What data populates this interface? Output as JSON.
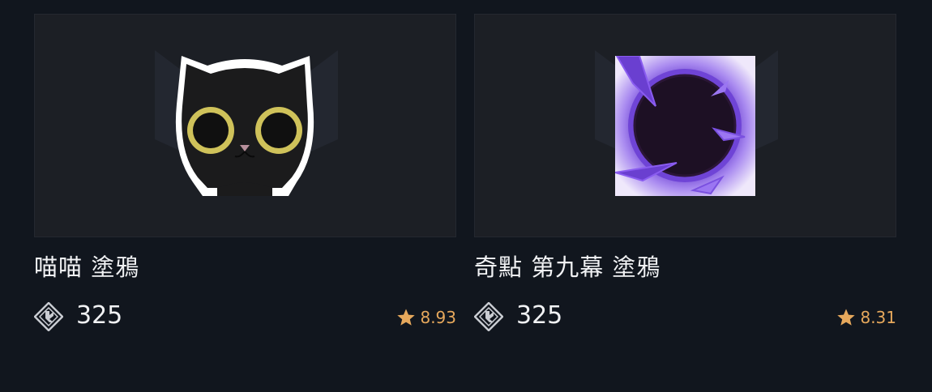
{
  "items": [
    {
      "title": "喵喵 塗鴉",
      "price": "325",
      "rating": "8.93",
      "thumbnail_icon": "black-cat-graffiti",
      "price_icon": "points-diamond-icon",
      "rating_icon": "star-icon"
    },
    {
      "title": "奇點 第九幕 塗鴉",
      "price": "325",
      "rating": "8.31",
      "thumbnail_icon": "purple-singularity-graffiti",
      "price_icon": "points-diamond-icon",
      "rating_icon": "star-icon"
    }
  ],
  "colors": {
    "background": "#11161e",
    "card_bg": "#1c1f25",
    "rating": "#e6a85c",
    "text": "#f1f2f4",
    "singularity_purple": "#8a5cf0"
  }
}
